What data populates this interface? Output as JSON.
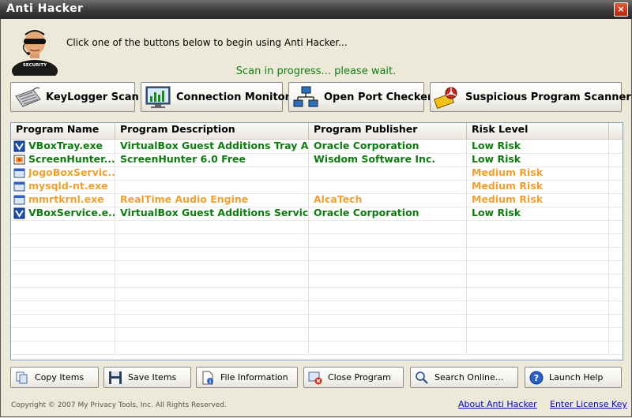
{
  "window": {
    "title": "Anti Hacker",
    "close_glyph": "×"
  },
  "intro_text": "Click one of the buttons below to begin using Anti Hacker...",
  "status_text": "Scan in progress... please wait.",
  "toolbar": [
    {
      "label": "KeyLogger Scan",
      "icon": "keyboard-icon"
    },
    {
      "label": "Connection Monitor",
      "icon": "monitor-chart-icon"
    },
    {
      "label": "Open Port Checker",
      "icon": "network-icon"
    },
    {
      "label": "Suspicious Program Scanner",
      "icon": "biohazard-icon"
    }
  ],
  "table": {
    "columns": [
      "Program Name",
      "Program Description",
      "Program Publisher",
      "Risk Level"
    ],
    "rows": [
      {
        "name": "VBoxTray.exe",
        "description": "VirtualBox Guest Additions Tray A...",
        "publisher": "Oracle Corporation",
        "risk": "Low Risk",
        "level": "low",
        "icon": "vbox-icon"
      },
      {
        "name": "ScreenHunter....",
        "description": "ScreenHunter 6.0 Free",
        "publisher": "Wisdom Software Inc.",
        "risk": "Low Risk",
        "level": "low",
        "icon": "screenhunter-icon"
      },
      {
        "name": "JogoBoxServic...",
        "description": "",
        "publisher": "",
        "risk": "Medium Risk",
        "level": "med",
        "icon": "window-app-icon"
      },
      {
        "name": "mysqld-nt.exe",
        "description": "",
        "publisher": "",
        "risk": "Medium Risk",
        "level": "med",
        "icon": "window-app-icon"
      },
      {
        "name": "mmrtkrnl.exe",
        "description": "RealTime Audio Engine",
        "publisher": "AlcaTech",
        "risk": "Medium Risk",
        "level": "med",
        "icon": "window-app-icon"
      },
      {
        "name": "VBoxService.e...",
        "description": "VirtualBox Guest Additions Service",
        "publisher": "Oracle Corporation",
        "risk": "Low Risk",
        "level": "low",
        "icon": "vbox-icon"
      }
    ]
  },
  "bottom_buttons": [
    {
      "label": "Copy Items",
      "icon": "copy-icon"
    },
    {
      "label": "Save Items",
      "icon": "floppy-disk-icon"
    },
    {
      "label": "File Information",
      "icon": "file-info-icon"
    },
    {
      "label": "Close Program",
      "icon": "close-program-icon"
    },
    {
      "label": "Search Online...",
      "icon": "search-icon"
    },
    {
      "label": "Launch Help",
      "icon": "help-icon"
    }
  ],
  "footer": {
    "copyright": "Copyright © 2007 My Privacy Tools, Inc. All Rights Reserved.",
    "about_link": "About Anti Hacker",
    "license_link": "Enter License Key"
  },
  "colors": {
    "low_risk": "#0f7a0f",
    "medium_risk": "#f0a030",
    "status_green": "#128012",
    "link_blue": "#0000c8"
  }
}
